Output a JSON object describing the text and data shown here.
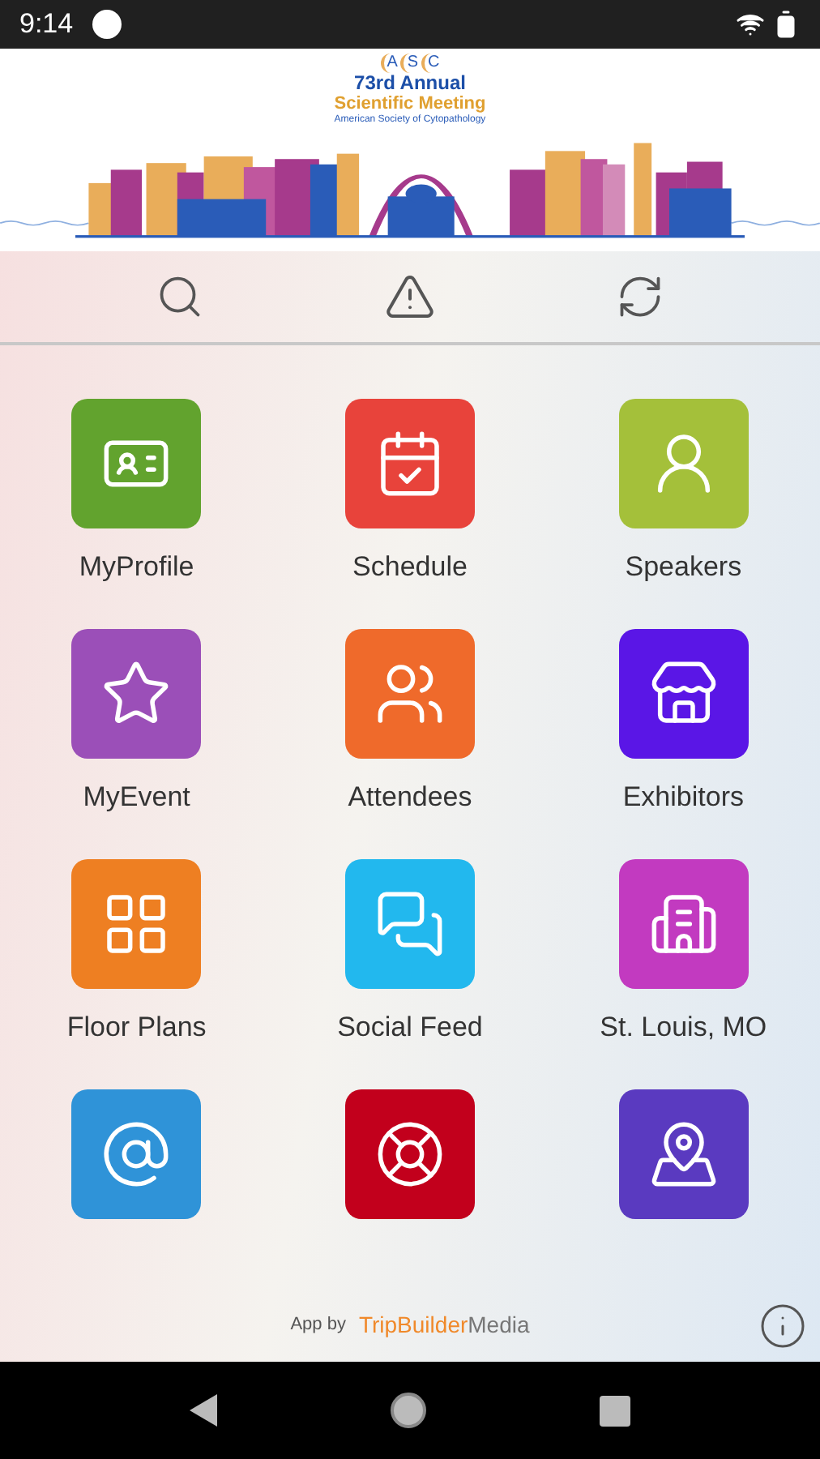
{
  "status_bar": {
    "time": "9:14"
  },
  "banner": {
    "logo_letters": [
      "A",
      "S",
      "C"
    ],
    "title": "73rd Annual",
    "subtitle": "Scientific Meeting",
    "society": "American Society of Cytopathology"
  },
  "tiles": [
    {
      "label": "MyProfile",
      "color": "#62a32e"
    },
    {
      "label": "Schedule",
      "color": "#e8433b"
    },
    {
      "label": "Speakers",
      "color": "#a4c03a"
    },
    {
      "label": "MyEvent",
      "color": "#9b4fb8"
    },
    {
      "label": "Attendees",
      "color": "#ef6a2b"
    },
    {
      "label": "Exhibitors",
      "color": "#5a16e6"
    },
    {
      "label": "Floor Plans",
      "color": "#ee7f22"
    },
    {
      "label": "Social Feed",
      "color": "#22b8ee"
    },
    {
      "label": "St. Louis, MO",
      "color": "#c23ac0"
    },
    {
      "color": "#2f93d8"
    },
    {
      "color": "#c2001c"
    },
    {
      "color": "#5a3ac0"
    }
  ],
  "footer": {
    "prefix": "App by",
    "brand_first": "TripBuilder",
    "brand_second": "Media"
  }
}
